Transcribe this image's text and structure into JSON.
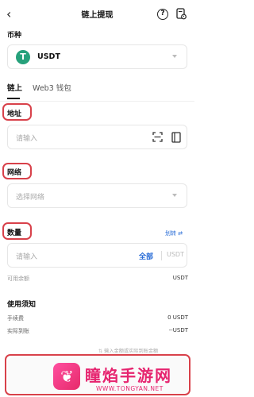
{
  "header": {
    "back_icon": "chevron-left-icon",
    "title": "链上提现",
    "help_icon": "question-circle-icon",
    "records_icon": "history-document-icon"
  },
  "coin": {
    "label": "币种",
    "selected": "USDT",
    "icon_letter": "T",
    "icon_color": "#26a17b"
  },
  "tabs": [
    {
      "label": "链上",
      "active": true
    },
    {
      "label": "Web3 钱包",
      "active": false
    }
  ],
  "address": {
    "label": "地址",
    "placeholder": "请输入"
  },
  "network": {
    "label": "网络",
    "placeholder": "选择网络"
  },
  "amount": {
    "label": "数量",
    "transfer_link": "划转 ⇄",
    "placeholder": "请输入",
    "all_button": "全部",
    "unit": "USDT",
    "available_label": "可用余额",
    "available_value": "USDT"
  },
  "notice": {
    "title": "使用须知",
    "fee_label": "手续费",
    "fee_value": "0 USDT",
    "received_label": "实际到账",
    "received_value": "--USDT",
    "hint": "输入金额或实际到账金额"
  },
  "watermark": {
    "title": "瞳焰手游网",
    "subtitle": "WWW.TONGYAN.NET"
  },
  "colors": {
    "accent_blue": "#2469d6",
    "highlight_red": "#d8414a",
    "brand_pink": "#e6246f"
  }
}
